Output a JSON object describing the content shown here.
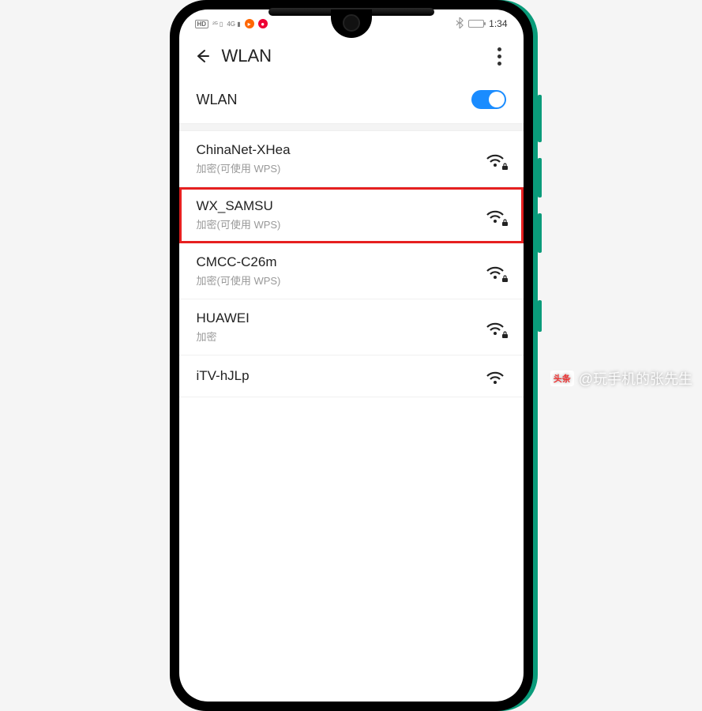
{
  "status": {
    "hd": "HD",
    "net_4g": "4G",
    "time": "1:34"
  },
  "header": {
    "title": "WLAN"
  },
  "wlan": {
    "label": "WLAN",
    "enabled": true
  },
  "networks": [
    {
      "name": "ChinaNet-XHea",
      "sub": "加密(可使用 WPS)",
      "locked": true,
      "highlight": false
    },
    {
      "name": "WX_SAMSU",
      "sub": "加密(可使用 WPS)",
      "locked": true,
      "highlight": true
    },
    {
      "name": "CMCC-C26m",
      "sub": "加密(可使用 WPS)",
      "locked": true,
      "highlight": false
    },
    {
      "name": "HUAWEI",
      "sub": "加密",
      "locked": true,
      "highlight": false
    },
    {
      "name": "iTV-hJLp",
      "sub": "",
      "locked": false,
      "highlight": false
    }
  ],
  "watermark": {
    "brand": "头条",
    "text": "@玩手机的张先生"
  }
}
